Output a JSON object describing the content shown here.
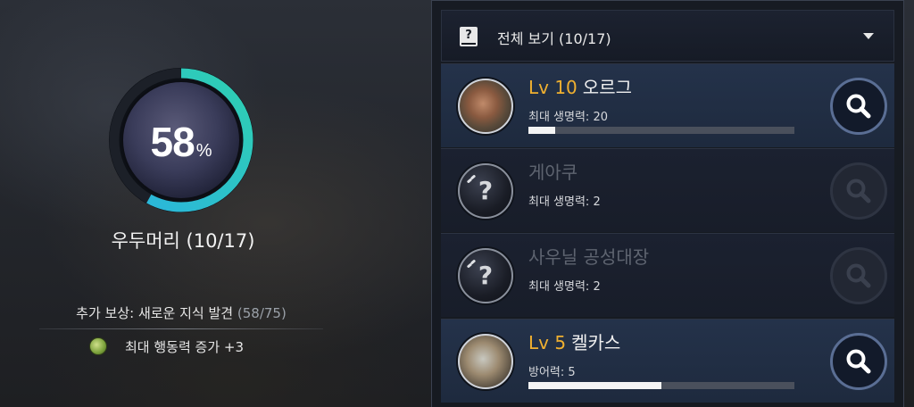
{
  "progress": {
    "percent": 58,
    "percent_value": "58",
    "percent_symbol": "%",
    "ring_color": "#2fd0b0",
    "ring_color_end": "#2ab3e0"
  },
  "collection": {
    "title": "우두머리 (10/17)"
  },
  "reward": {
    "label": "추가 보상: 새로운 지식 발견",
    "count": "(58/75)",
    "item_text": "최대 행동력 증가 +3",
    "item_icon": "leaf-icon"
  },
  "filter": {
    "icon": "book-question-icon",
    "label": "전체 보기 (10/17)",
    "dropdown_icon": "triangle-down-icon"
  },
  "entries": [
    {
      "known": true,
      "level": "Lv 10",
      "name": "오르그",
      "stat": "최대 생명력: 20",
      "progress": 0.1,
      "portrait": "orc-portrait"
    },
    {
      "known": false,
      "level": "",
      "name": "게아쿠",
      "stat": "최대 생명력: 2",
      "progress": 0,
      "portrait": "unknown-portrait"
    },
    {
      "known": false,
      "level": "",
      "name": "사우닐 공성대장",
      "stat": "최대 생명력: 2",
      "progress": 0,
      "portrait": "unknown-portrait"
    },
    {
      "known": true,
      "level": "Lv 5",
      "name": "켈카스",
      "stat": "방어력: 5",
      "progress": 0.5,
      "portrait": "kelcas-portrait"
    }
  ]
}
